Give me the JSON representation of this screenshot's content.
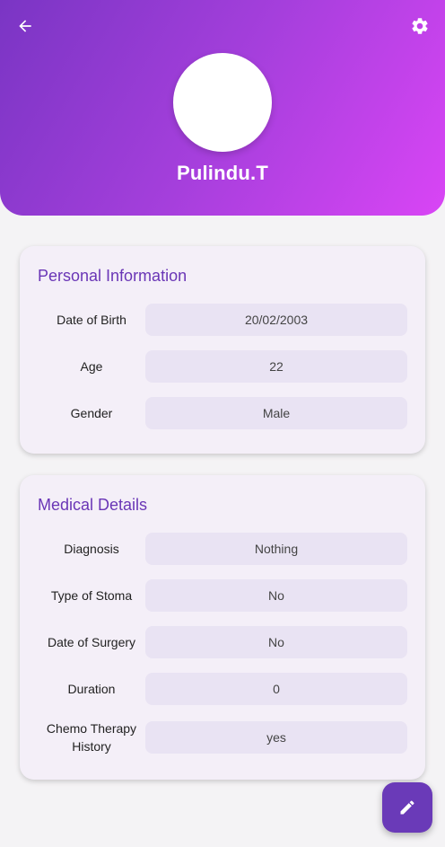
{
  "profile": {
    "name": "Pulindu.T"
  },
  "icons": {
    "back": "arrow-left-icon",
    "settings": "gear-icon",
    "edit": "pencil-icon"
  },
  "colors": {
    "header_gradient_start": "#7a35c4",
    "header_gradient_end": "#d945f5",
    "accent": "#6a36b6",
    "card_background": "#f4eff8",
    "value_background": "#e9e3f3"
  },
  "personal": {
    "title": "Personal Information",
    "rows": [
      {
        "label": "Date of Birth",
        "value": "20/02/2003"
      },
      {
        "label": "Age",
        "value": "22"
      },
      {
        "label": "Gender",
        "value": "Male"
      }
    ]
  },
  "medical": {
    "title": "Medical Details",
    "rows": [
      {
        "label": "Diagnosis",
        "value": "Nothing"
      },
      {
        "label": "Type of Stoma",
        "value": "No"
      },
      {
        "label": "Date of Surgery",
        "value": "No"
      },
      {
        "label": "Duration",
        "value": "0"
      },
      {
        "label": "Chemo Therapy History",
        "value": "yes"
      }
    ]
  }
}
